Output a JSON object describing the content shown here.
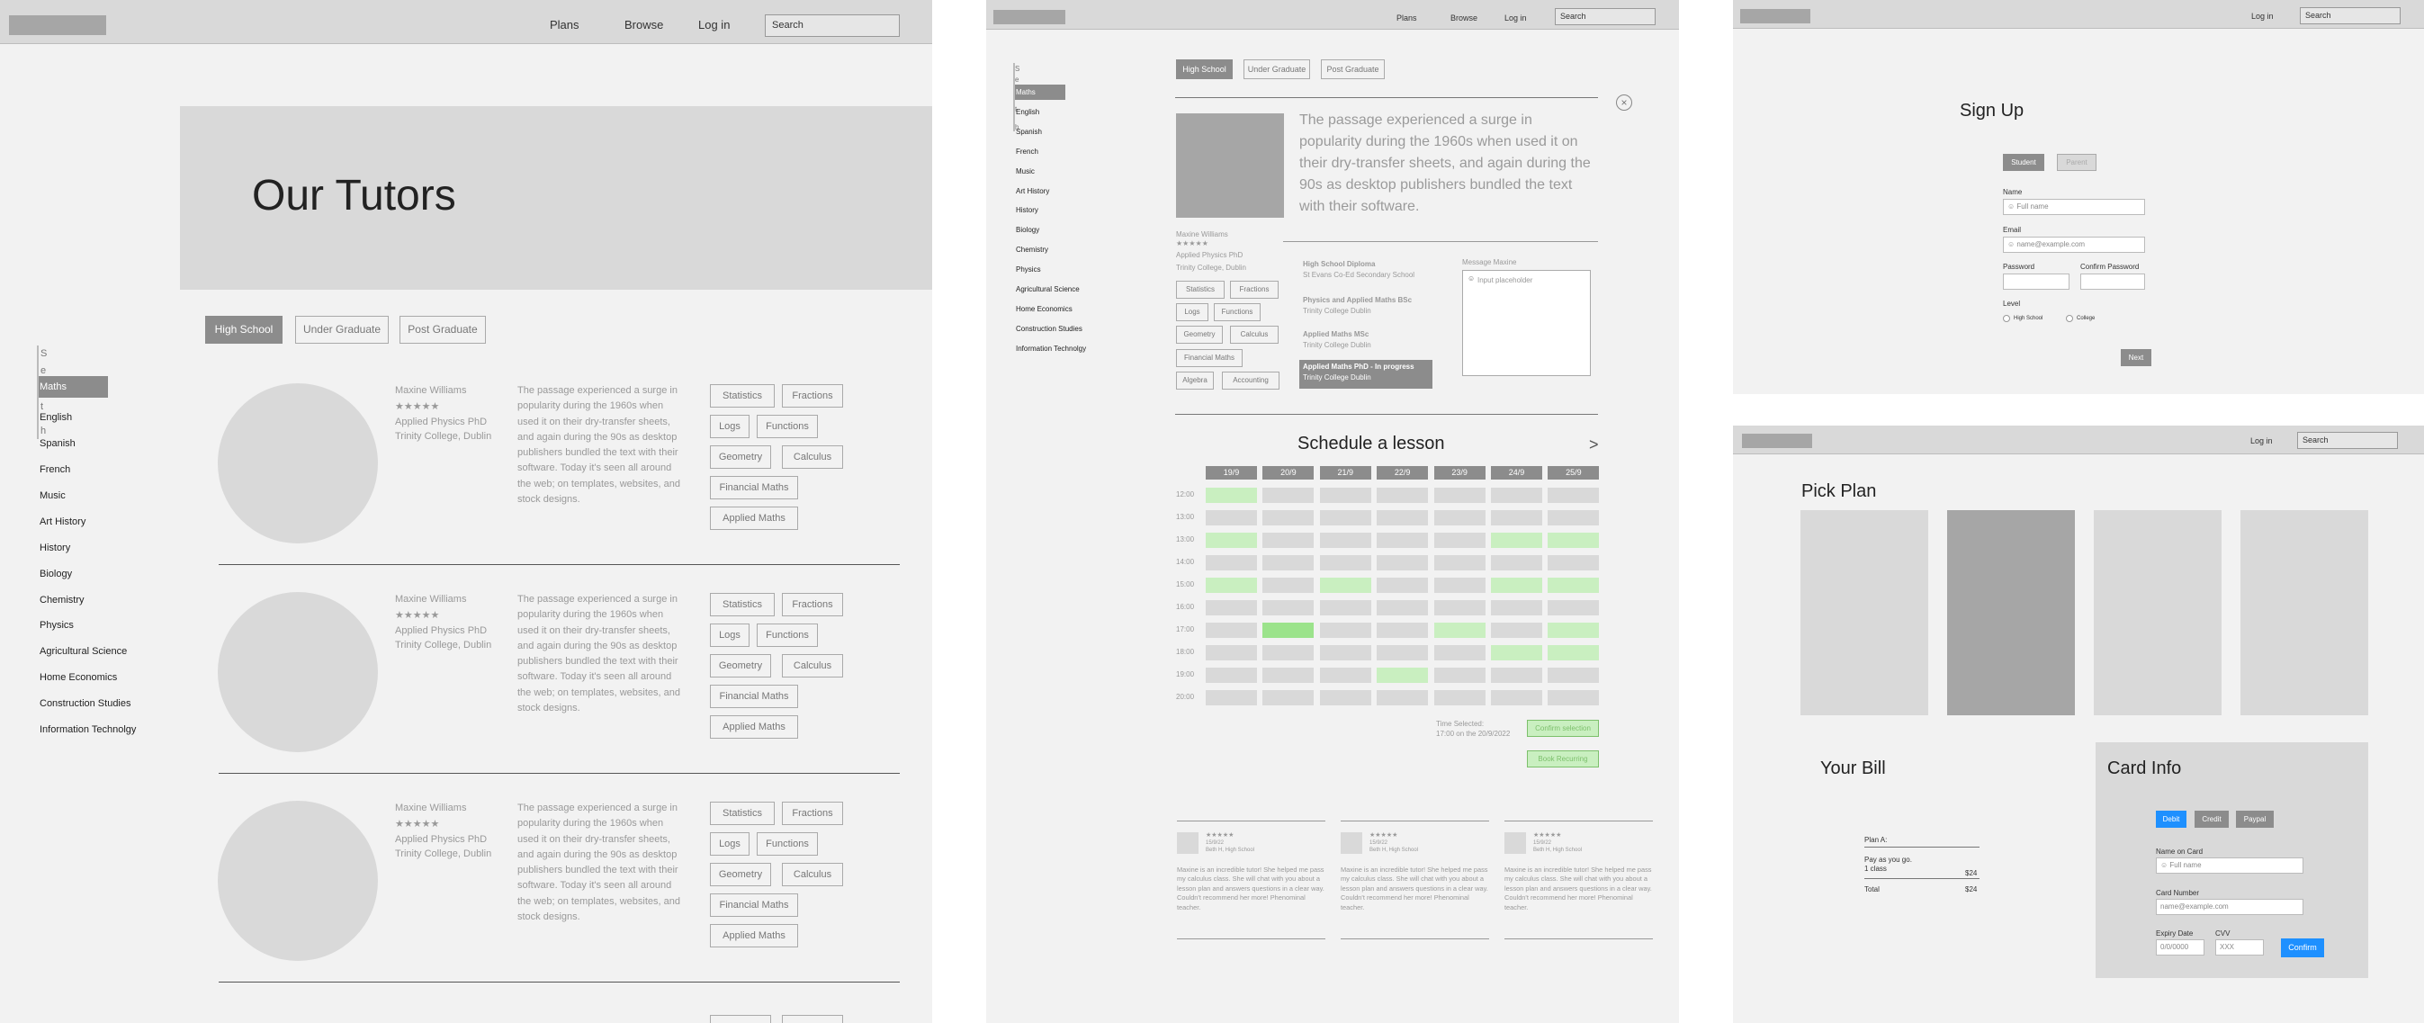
{
  "tutors_page": {
    "nav": {
      "plans": "Plans",
      "browse": "Browse",
      "login": "Log in",
      "search_value": "Search"
    },
    "hero_title": "Our Tutors",
    "level_tabs": [
      "High School",
      "Under Graduate",
      "Post Graduate"
    ],
    "subjects": [
      "Maths",
      "English",
      "Spanish",
      "French",
      "Music",
      "Art History",
      "History",
      "Biology",
      "Chemistry",
      "Physics",
      "Agricultural Science",
      "Home Economics",
      "Construction Studies",
      "Information Technolgy"
    ],
    "side_letters": [
      "S",
      "e",
      "t",
      "h"
    ],
    "tutors": [
      {
        "name": "Maxine Williams",
        "stars": "★★★★★",
        "degree": "Applied Physics PhD",
        "college": "Trinity College, Dublin",
        "bio": "The passage experienced a surge in popularity during the 1960s when used it on their dry-transfer sheets, and again during the 90s as desktop publishers bundled the text with their software. Today it's seen all around the web; on templates, websites, and stock designs.",
        "tags": [
          "Statistics",
          "Fractions",
          "Logs",
          "Functions",
          "Geometry",
          "Calculus",
          "Financial Maths",
          "Applied Maths"
        ]
      },
      {
        "name": "Maxine Williams",
        "stars": "★★★★★",
        "degree": "Applied Physics PhD",
        "college": "Trinity College, Dublin",
        "bio": "The passage experienced a surge in popularity during the 1960s when used it on their dry-transfer sheets, and again during the 90s as desktop publishers bundled the text with their software. Today it's seen all around the web; on templates, websites, and stock designs.",
        "tags": [
          "Statistics",
          "Fractions",
          "Logs",
          "Functions",
          "Geometry",
          "Calculus",
          "Financial Maths",
          "Applied Maths"
        ]
      },
      {
        "name": "Maxine Williams",
        "stars": "★★★★★",
        "degree": "Applied Physics PhD",
        "college": "Trinity College, Dublin",
        "bio": "The passage experienced a surge in popularity during the 1960s when used it on their dry-transfer sheets, and again during the 90s as desktop publishers bundled the text with their software. Today it's seen all around the web; on templates, websites, and stock designs.",
        "tags": [
          "Statistics",
          "Fractions",
          "Logs",
          "Functions",
          "Geometry",
          "Calculus",
          "Financial Maths",
          "Applied Maths"
        ]
      }
    ]
  },
  "profile_page": {
    "nav": {
      "plans": "Plans",
      "browse": "Browse",
      "login": "Log in",
      "search_value": "Search"
    },
    "level_tabs": [
      "High School",
      "Under Graduate",
      "Post Graduate"
    ],
    "subjects": [
      "Maths",
      "English",
      "Spanish",
      "French",
      "Music",
      "Art History",
      "History",
      "Biology",
      "Chemistry",
      "Physics",
      "Agricultural Science",
      "Home Economics",
      "Construction Studies",
      "Information Technolgy"
    ],
    "side_letters": [
      "S",
      "e",
      "t",
      "h"
    ],
    "intro": "The passage experienced a surge in popularity during the 1960s when used it on their dry-transfer sheets, and again during the 90s as desktop publishers bundled the text with their software.",
    "name": "Maxine Williams",
    "stars": "★★★★★",
    "degree": "Applied Physics PhD",
    "college": "Trinity College, Dublin",
    "tags": [
      "Statistics",
      "Fractions",
      "Logs",
      "Functions",
      "Geometry",
      "Calculus",
      "Financial Maths",
      "Algebra",
      "Accounting"
    ],
    "education": [
      {
        "title": "High School Diploma",
        "place": "St Evans Co-Ed Secondary School",
        "highlight": false
      },
      {
        "title": "Physics and Applied Maths BSc",
        "place": "Trinity College Dublin",
        "highlight": false
      },
      {
        "title": "Applied Maths MSc",
        "place": "Trinity College Dublin",
        "highlight": false
      },
      {
        "title": "Applied Maths PhD - In progress",
        "place": "Trinity College Dublin",
        "highlight": true
      }
    ],
    "message_label": "Message Maxine",
    "message_placeholder": "Input placeholder",
    "schedule_title": "Schedule a lesson",
    "schedule_next": ">",
    "days": [
      "19/9",
      "20/9",
      "21/9",
      "22/9",
      "23/9",
      "24/9",
      "25/9"
    ],
    "times": [
      "12:00",
      "13:00",
      "13:00",
      "14:00",
      "15:00",
      "16:00",
      "17:00",
      "18:00",
      "19:00",
      "20:00"
    ],
    "availability": [
      [
        1,
        0,
        0,
        0,
        0,
        0,
        0
      ],
      [
        0,
        0,
        0,
        0,
        0,
        0,
        0
      ],
      [
        1,
        0,
        0,
        0,
        0,
        1,
        1
      ],
      [
        0,
        0,
        0,
        0,
        0,
        0,
        0
      ],
      [
        1,
        0,
        1,
        0,
        0,
        1,
        1
      ],
      [
        0,
        0,
        0,
        0,
        0,
        0,
        0
      ],
      [
        0,
        2,
        0,
        0,
        1,
        0,
        1
      ],
      [
        0,
        0,
        0,
        0,
        0,
        1,
        1
      ],
      [
        0,
        0,
        0,
        1,
        0,
        0,
        0
      ],
      [
        0,
        0,
        0,
        0,
        0,
        0,
        0
      ]
    ],
    "time_selected_label": "Time Selected:",
    "time_selected_value": "17:00 on the 20/9/2022",
    "confirm_label": "Confirm selection",
    "book_label": "Book Recurring",
    "reviews": [
      {
        "stars": "★★★★★",
        "date": "15/9/22",
        "who": "Beth H, High School",
        "text": "Maxine is an incredible tutor! She helped me pass my calculus class. She will chat with you about a lesson plan and answers questions in a clear way. Couldn't recommend her more! Phenominal teacher."
      },
      {
        "stars": "★★★★★",
        "date": "15/9/22",
        "who": "Beth H, High School",
        "text": "Maxine is an incredible tutor! She helped me pass my calculus class. She will chat with you about a lesson plan and answers questions in a clear way. Couldn't recommend her more! Phenominal teacher."
      },
      {
        "stars": "★★★★★",
        "date": "15/9/22",
        "who": "Beth H, High School",
        "text": "Maxine is an incredible tutor! She helped me pass my calculus class. She will chat with you about a lesson plan and answers questions in a clear way. Couldn't recommend her more! Phenominal teacher."
      }
    ]
  },
  "signup_page": {
    "nav": {
      "login": "Log in",
      "search_value": "Search"
    },
    "title": "Sign Up",
    "student": "Student",
    "parent": "Parent",
    "name_label": "Name",
    "name_placeholder": "Full name",
    "email_label": "Email",
    "email_placeholder": "name@example.com",
    "password_label": "Password",
    "confirm_label": "Confirm Password",
    "level_label": "Level",
    "high_school": "High School",
    "college": "College",
    "next": "Next"
  },
  "plan_page": {
    "nav": {
      "login": "Log in",
      "search_value": "Search"
    },
    "title": "Pick Plan",
    "bill_title": "Your Bill",
    "plan_label": "Plan A:",
    "payg_1": "Pay as you go.",
    "payg_2": "1 class",
    "price": "$24",
    "total_label": "Total",
    "total": "$24",
    "card_title": "Card Info",
    "debit": "Debit",
    "credit": "Credit",
    "paypal": "Paypal",
    "name_on_card": "Name on Card",
    "name_placeholder": "Full name",
    "card_number": "Card Number",
    "card_placeholder": "name@example.com",
    "expiry": "Expiry Date",
    "expiry_placeholder": "0/0/0000",
    "cvv": "CVV",
    "cvv_placeholder": "XXX",
    "confirm": "Confirm"
  },
  "colors": {
    "panel_bg": "#f2f2f2",
    "bar_bg": "#d9d9d9",
    "active": "#8c8c8c",
    "avail": "#c9efc0",
    "selected": "#9be38b",
    "blue": "#1e90ff"
  }
}
